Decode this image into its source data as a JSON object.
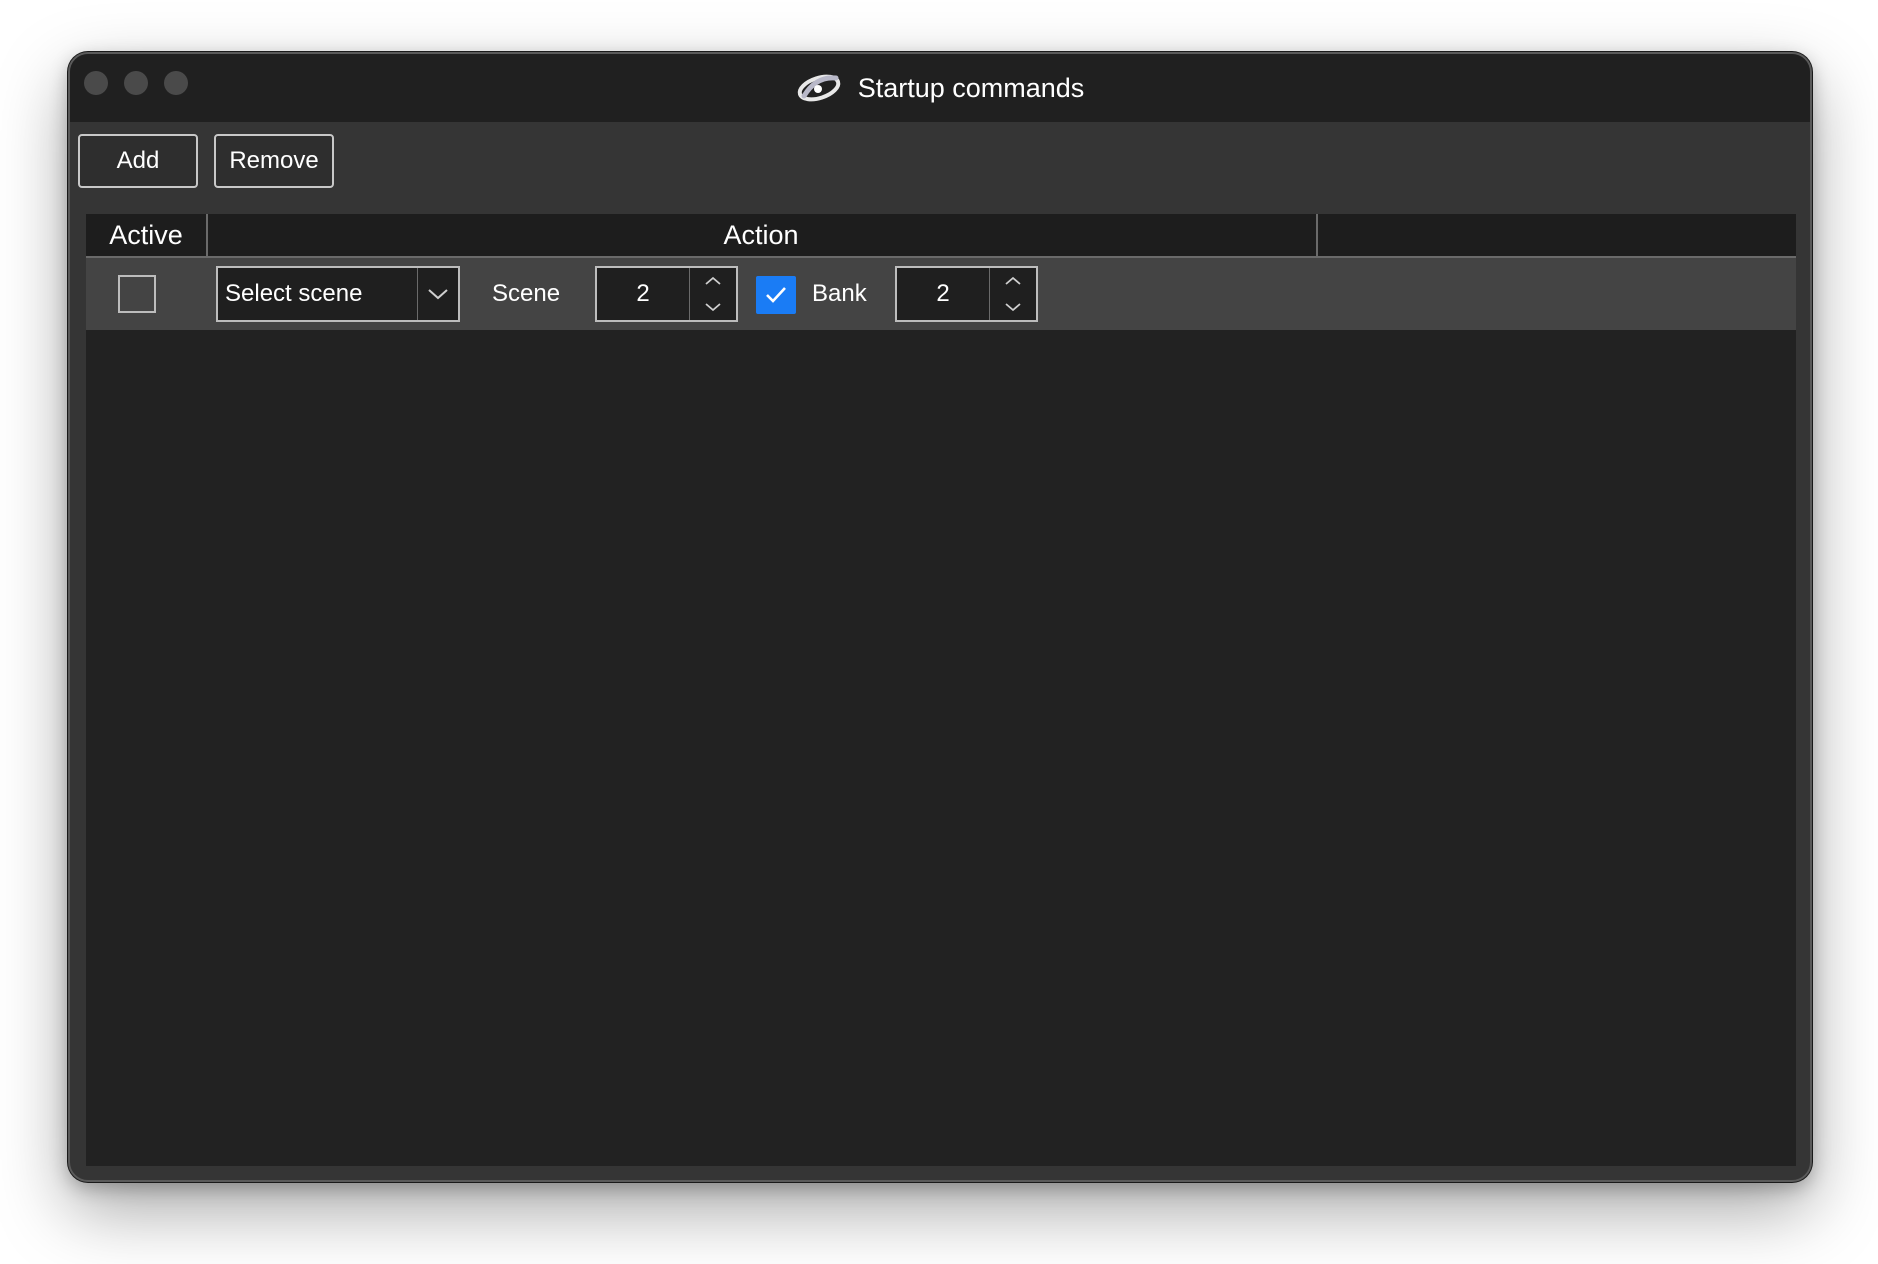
{
  "window": {
    "title": "Startup commands",
    "logo_icon": "app-logo-icon"
  },
  "toolbar": {
    "add_label": "Add",
    "remove_label": "Remove"
  },
  "table": {
    "columns": [
      "Active",
      "Action",
      ""
    ],
    "rows": [
      {
        "active": false,
        "action_select": "Select scene",
        "scene_label": "Scene",
        "scene_value": "2",
        "bank_enabled": true,
        "bank_label": "Bank",
        "bank_value": "2"
      }
    ]
  },
  "colors": {
    "accent": "#1a7cf5",
    "window_bg": "#353535",
    "titlebar_bg": "#202020",
    "table_bg": "#222222",
    "row_bg": "#444444"
  }
}
